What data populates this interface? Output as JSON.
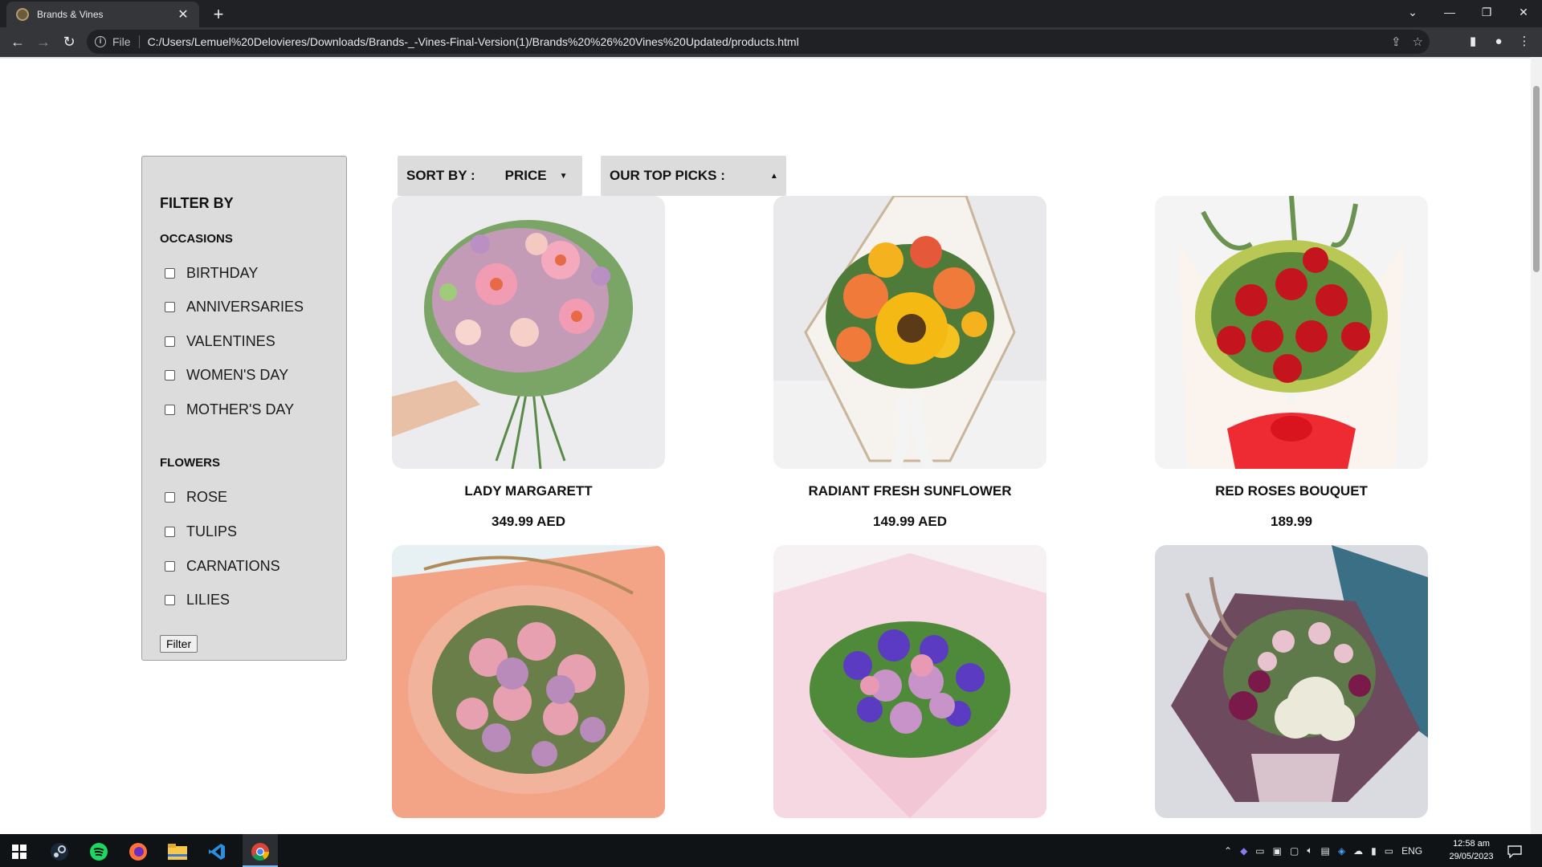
{
  "browser": {
    "tab_title": "Brands & Vines",
    "url_scheme": "File",
    "url": "C:/Users/Lemuel%20Delovieres/Downloads/Brands-_-Vines-Final-Version(1)/Brands%20%26%20Vines%20Updated/products.html"
  },
  "filters": {
    "title": "FILTER BY",
    "occasions_title": "OCCASIONS",
    "occasions": [
      "BIRTHDAY",
      "ANNIVERSARIES",
      "VALENTINES",
      "WOMEN'S DAY",
      "MOTHER'S DAY"
    ],
    "flowers_title": "FLOWERS",
    "flowers": [
      "ROSE",
      "TULIPS",
      "CARNATIONS",
      "LILIES"
    ],
    "button_label": "Filter"
  },
  "sort": {
    "label": "SORT BY :",
    "value": "PRICE",
    "top_picks_label": "OUR TOP PICKS :"
  },
  "products": [
    {
      "name": "LADY MARGARETT",
      "price": "349.99 AED"
    },
    {
      "name": "RADIANT FRESH SUNFLOWER",
      "price": "149.99 AED"
    },
    {
      "name": "RED ROSES BOUQUET",
      "price": "189.99"
    },
    {
      "name": "",
      "price": ""
    },
    {
      "name": "",
      "price": ""
    },
    {
      "name": "",
      "price": ""
    }
  ],
  "taskbar": {
    "language": "ENG",
    "time": "12:58 am",
    "date": "29/05/2023"
  }
}
